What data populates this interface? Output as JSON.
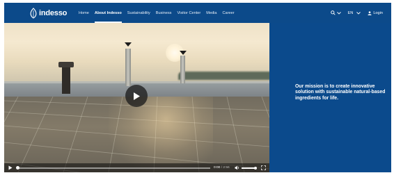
{
  "header": {
    "logo_text": "indesso",
    "nav": [
      {
        "label": "Home",
        "active": false
      },
      {
        "label": "About Indesso",
        "active": true
      },
      {
        "label": "Sustainability",
        "active": false
      },
      {
        "label": "Business",
        "active": false
      },
      {
        "label": "Visitor Center",
        "active": false
      },
      {
        "label": "Media",
        "active": false
      },
      {
        "label": "Career",
        "active": false
      }
    ],
    "search_icon": "search-icon",
    "language": "EN",
    "login_label": "Login",
    "background_color": "#0c4a8a"
  },
  "video": {
    "current_time": "0:00",
    "duration": "/ 2:56",
    "play_icon": "play-icon",
    "volume_icon": "volume-icon",
    "fullscreen_icon": "fullscreen-icon"
  },
  "mission": {
    "text": "Our mission is to create innovative solution with sustainable natural-based ingredients for life.",
    "background_color": "#0b4a8c"
  }
}
